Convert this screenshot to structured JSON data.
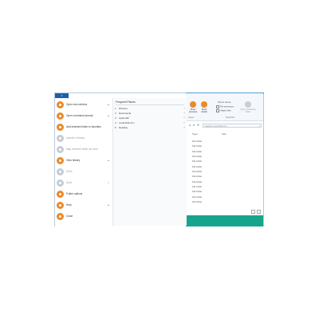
{
  "file_button": {
    "label": "",
    "caret": "▾"
  },
  "ribbon": {
    "buttons": [
      {
        "label": "Show previews",
        "icon": "preview-icon"
      },
      {
        "label": "Show details",
        "icon": "details-icon"
      },
      {
        "label": "Open containing folder",
        "icon": "open-folder-icon"
      }
    ],
    "group_label": "Layout",
    "group_label2": "Show/hide",
    "checks": [
      "Picture names",
      "File extensions",
      "Hidden files"
    ]
  },
  "nav": {
    "back": "◂",
    "down": "▾",
    "refresh": "⟳",
    "search_placeholder": "Search Local Disk (C:)"
  },
  "columns": {
    "type": "Type",
    "size": "Size"
  },
  "rows": [
    "File folder",
    "File folder",
    "File folder",
    "File folder",
    "File folder",
    "File folder",
    "File folder",
    "File folder",
    "File folder",
    "File folder",
    "File folder",
    "File folder",
    "File folder"
  ],
  "menu": {
    "items": [
      {
        "label": "Open new window",
        "chevron": "▸",
        "disabled": false
      },
      {
        "label": "Open command prompt",
        "chevron": "▸",
        "disabled": false
      },
      {
        "label": "Add selected folder to favorites",
        "chevron": "",
        "disabled": false
      },
      {
        "label": "Include in library",
        "chevron": "",
        "disabled": true
      },
      {
        "label": "Map selected folder as drive",
        "chevron": "",
        "disabled": true
      },
      {
        "label": "View history",
        "chevron": "▸",
        "disabled": false
      },
      {
        "label": "Send",
        "chevron": "",
        "disabled": true
      },
      {
        "label": "Sync",
        "chevron": "▸",
        "disabled": true
      },
      {
        "label": "Folder options",
        "chevron": "",
        "disabled": false
      },
      {
        "label": "Help",
        "chevron": "▸",
        "disabled": false
      },
      {
        "label": "Close",
        "chevron": "",
        "disabled": false
      }
    ]
  },
  "frequent": {
    "title": "Frequent Places",
    "items": [
      {
        "num": "1",
        "label": "Pictures"
      },
      {
        "num": "2",
        "label": "Documents"
      },
      {
        "num": "3",
        "label": "system32"
      },
      {
        "num": "4",
        "label": "Local Disk (C:)"
      },
      {
        "num": "5",
        "label": "Desktop"
      }
    ],
    "pin": "⊸"
  },
  "colors": {
    "accent": "#e88a2c",
    "taskbar": "#16a48d",
    "file_button": "#1e5fa8"
  }
}
